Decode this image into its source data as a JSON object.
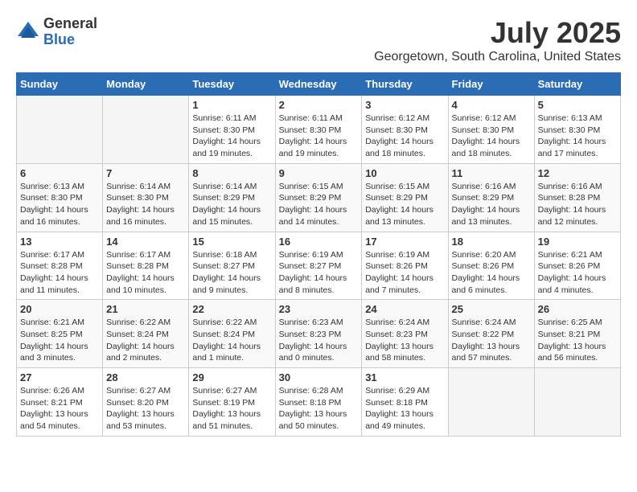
{
  "logo": {
    "general": "General",
    "blue": "Blue"
  },
  "title": "July 2025",
  "location": "Georgetown, South Carolina, United States",
  "days_of_week": [
    "Sunday",
    "Monday",
    "Tuesday",
    "Wednesday",
    "Thursday",
    "Friday",
    "Saturday"
  ],
  "weeks": [
    [
      {
        "day": "",
        "info": ""
      },
      {
        "day": "",
        "info": ""
      },
      {
        "day": "1",
        "info": "Sunrise: 6:11 AM\nSunset: 8:30 PM\nDaylight: 14 hours and 19 minutes."
      },
      {
        "day": "2",
        "info": "Sunrise: 6:11 AM\nSunset: 8:30 PM\nDaylight: 14 hours and 19 minutes."
      },
      {
        "day": "3",
        "info": "Sunrise: 6:12 AM\nSunset: 8:30 PM\nDaylight: 14 hours and 18 minutes."
      },
      {
        "day": "4",
        "info": "Sunrise: 6:12 AM\nSunset: 8:30 PM\nDaylight: 14 hours and 18 minutes."
      },
      {
        "day": "5",
        "info": "Sunrise: 6:13 AM\nSunset: 8:30 PM\nDaylight: 14 hours and 17 minutes."
      }
    ],
    [
      {
        "day": "6",
        "info": "Sunrise: 6:13 AM\nSunset: 8:30 PM\nDaylight: 14 hours and 16 minutes."
      },
      {
        "day": "7",
        "info": "Sunrise: 6:14 AM\nSunset: 8:30 PM\nDaylight: 14 hours and 16 minutes."
      },
      {
        "day": "8",
        "info": "Sunrise: 6:14 AM\nSunset: 8:29 PM\nDaylight: 14 hours and 15 minutes."
      },
      {
        "day": "9",
        "info": "Sunrise: 6:15 AM\nSunset: 8:29 PM\nDaylight: 14 hours and 14 minutes."
      },
      {
        "day": "10",
        "info": "Sunrise: 6:15 AM\nSunset: 8:29 PM\nDaylight: 14 hours and 13 minutes."
      },
      {
        "day": "11",
        "info": "Sunrise: 6:16 AM\nSunset: 8:29 PM\nDaylight: 14 hours and 13 minutes."
      },
      {
        "day": "12",
        "info": "Sunrise: 6:16 AM\nSunset: 8:28 PM\nDaylight: 14 hours and 12 minutes."
      }
    ],
    [
      {
        "day": "13",
        "info": "Sunrise: 6:17 AM\nSunset: 8:28 PM\nDaylight: 14 hours and 11 minutes."
      },
      {
        "day": "14",
        "info": "Sunrise: 6:17 AM\nSunset: 8:28 PM\nDaylight: 14 hours and 10 minutes."
      },
      {
        "day": "15",
        "info": "Sunrise: 6:18 AM\nSunset: 8:27 PM\nDaylight: 14 hours and 9 minutes."
      },
      {
        "day": "16",
        "info": "Sunrise: 6:19 AM\nSunset: 8:27 PM\nDaylight: 14 hours and 8 minutes."
      },
      {
        "day": "17",
        "info": "Sunrise: 6:19 AM\nSunset: 8:26 PM\nDaylight: 14 hours and 7 minutes."
      },
      {
        "day": "18",
        "info": "Sunrise: 6:20 AM\nSunset: 8:26 PM\nDaylight: 14 hours and 6 minutes."
      },
      {
        "day": "19",
        "info": "Sunrise: 6:21 AM\nSunset: 8:26 PM\nDaylight: 14 hours and 4 minutes."
      }
    ],
    [
      {
        "day": "20",
        "info": "Sunrise: 6:21 AM\nSunset: 8:25 PM\nDaylight: 14 hours and 3 minutes."
      },
      {
        "day": "21",
        "info": "Sunrise: 6:22 AM\nSunset: 8:24 PM\nDaylight: 14 hours and 2 minutes."
      },
      {
        "day": "22",
        "info": "Sunrise: 6:22 AM\nSunset: 8:24 PM\nDaylight: 14 hours and 1 minute."
      },
      {
        "day": "23",
        "info": "Sunrise: 6:23 AM\nSunset: 8:23 PM\nDaylight: 14 hours and 0 minutes."
      },
      {
        "day": "24",
        "info": "Sunrise: 6:24 AM\nSunset: 8:23 PM\nDaylight: 13 hours and 58 minutes."
      },
      {
        "day": "25",
        "info": "Sunrise: 6:24 AM\nSunset: 8:22 PM\nDaylight: 13 hours and 57 minutes."
      },
      {
        "day": "26",
        "info": "Sunrise: 6:25 AM\nSunset: 8:21 PM\nDaylight: 13 hours and 56 minutes."
      }
    ],
    [
      {
        "day": "27",
        "info": "Sunrise: 6:26 AM\nSunset: 8:21 PM\nDaylight: 13 hours and 54 minutes."
      },
      {
        "day": "28",
        "info": "Sunrise: 6:27 AM\nSunset: 8:20 PM\nDaylight: 13 hours and 53 minutes."
      },
      {
        "day": "29",
        "info": "Sunrise: 6:27 AM\nSunset: 8:19 PM\nDaylight: 13 hours and 51 minutes."
      },
      {
        "day": "30",
        "info": "Sunrise: 6:28 AM\nSunset: 8:18 PM\nDaylight: 13 hours and 50 minutes."
      },
      {
        "day": "31",
        "info": "Sunrise: 6:29 AM\nSunset: 8:18 PM\nDaylight: 13 hours and 49 minutes."
      },
      {
        "day": "",
        "info": ""
      },
      {
        "day": "",
        "info": ""
      }
    ]
  ]
}
